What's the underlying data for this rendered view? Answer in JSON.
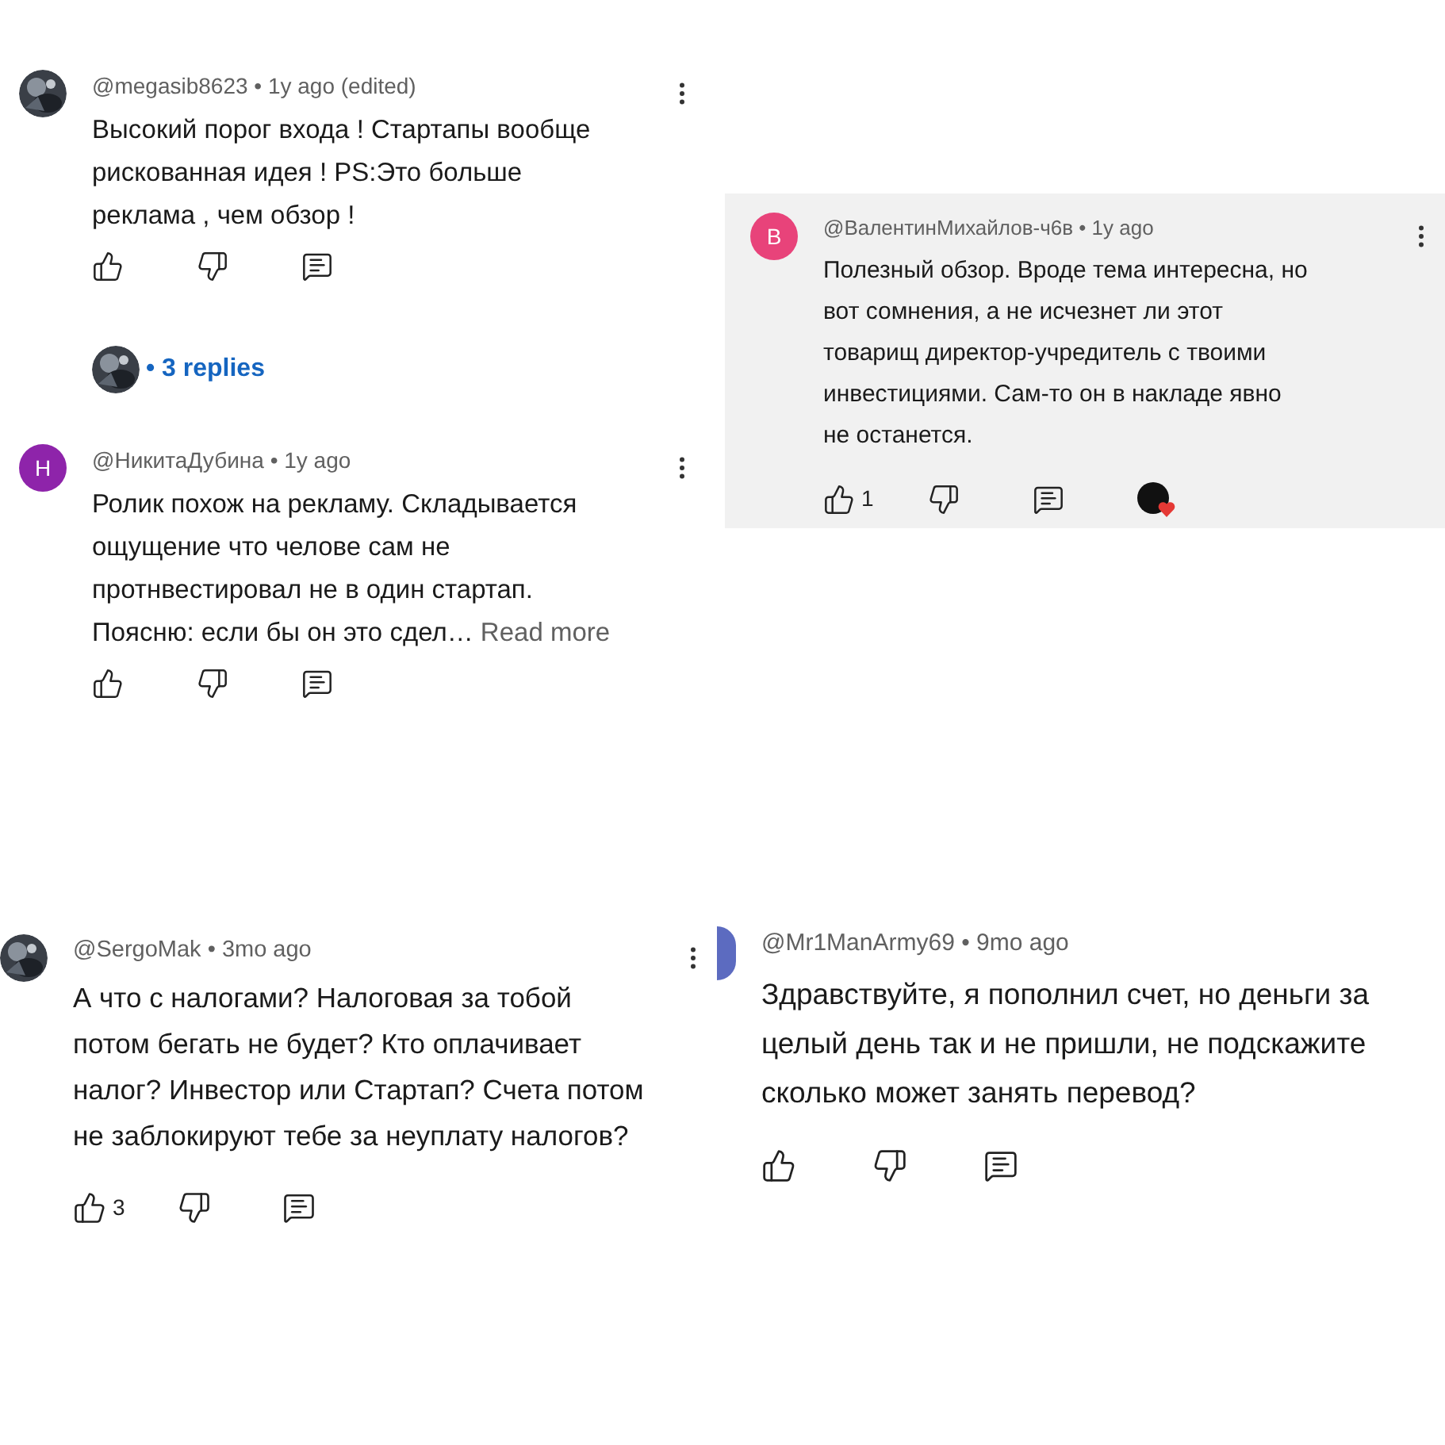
{
  "panels": [
    {
      "shaded": false,
      "comments": [
        {
          "header": "@megasib8623 • 1y ago (edited)",
          "text": "Высокий порог входа ! Стартапы вообще рискованная идея ! PS:Это больше реклама , чем обзор !",
          "creator_heart": false,
          "menu": true,
          "replies": "• 3 replies"
        },
        {
          "avatar": {
            "kind": "letter",
            "letter": "Н",
            "color": "#8e24aa"
          },
          "header": "@НикитаДубина • 1y ago",
          "text": "Ролик похож на рекламу. Складывается ощущение что челове сам не протнвестировал не в один стартап. Поясню: если бы он это сдел…",
          "read_more": "Read more",
          "creator_heart": false,
          "menu": true
        }
      ]
    },
    {
      "shaded": true,
      "comments": [
        {
          "avatar": {
            "kind": "letter",
            "letter": "В",
            "color": "#e8437a"
          },
          "header": "@ВалентинМихайлов-ч6в • 1y ago",
          "text": "Полезный обзор. Вроде тема интересна, но вот сомнения, а не исчезнет ли этот товарищ директор-учредитель с твоими инвестициями. Сам-то он в накладе явно не останется.",
          "likes": "1",
          "creator_heart": true,
          "menu": true
        }
      ]
    },
    {
      "shaded": false,
      "comments": [
        {
          "header": "@SergoMak • 3mo ago",
          "text": "А что с налогами? Налоговая за тобой потом бегать не будет? Кто оплачивает налог? Инвестор или Стартап? Счета потом не заблокируют тебе за неуплату налогов?",
          "likes": "3",
          "creator_heart": false,
          "menu": true
        }
      ]
    },
    {
      "shaded": false,
      "comments": [
        {
          "avatar": {
            "kind": "partial",
            "color": "#5c6bc0"
          },
          "header": "@Mr1ManArmy69 • 9mo ago",
          "text": "Здравствуйте, я пополнил счет, но деньги за целый день так и не пришли, не подскажите сколько может занять перевод?",
          "creator_heart": false,
          "menu": false
        }
      ]
    }
  ]
}
